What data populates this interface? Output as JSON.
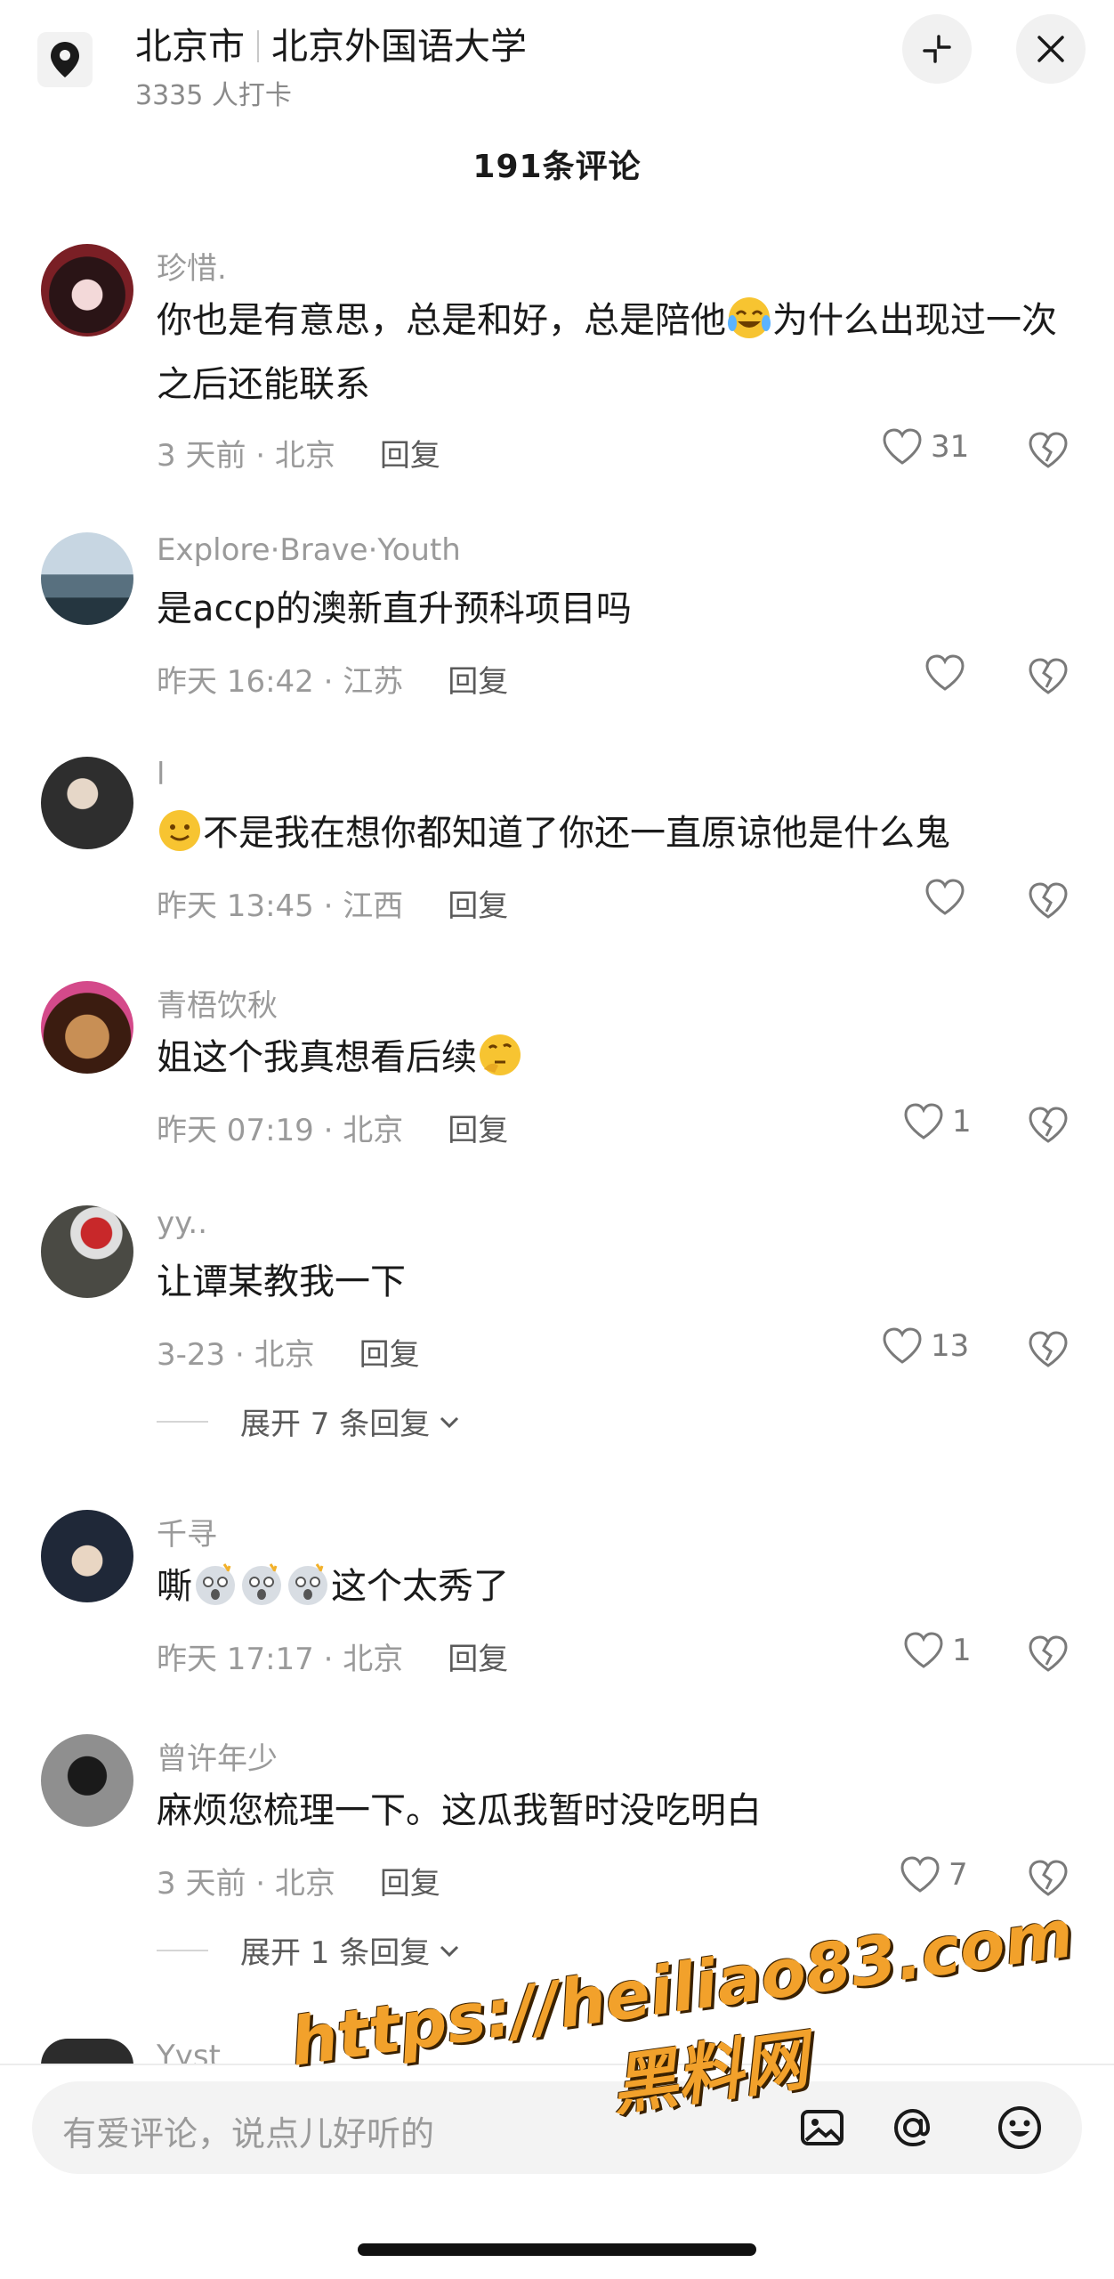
{
  "header": {
    "city": "北京市",
    "place": "北京外国语大学",
    "checkin": "3335 人打卡"
  },
  "comment_count": "191条评论",
  "comments": [
    {
      "user": "珍惜.",
      "text": "你也是有意思，总是和好，总是陪他",
      "emoji_name": "crying-laughing-emoji",
      "text_after": "为什么出现过一次之后还能联系",
      "time": "3 天前 · 北京",
      "reply": "回复",
      "likes": "31"
    },
    {
      "user": "Explore·Brave·Youth",
      "text": "是accp的澳新直升预科项目吗",
      "time": "昨天 16:42 · 江苏",
      "reply": "回复",
      "likes": ""
    },
    {
      "user": "l",
      "emoji_name": "slightly-smiling-emoji",
      "text": "不是我在想你都知道了你还一直原谅他是什么鬼",
      "time": "昨天 13:45 · 江西",
      "reply": "回复",
      "likes": ""
    },
    {
      "user": "青梧饮秋",
      "text": "姐这个我真想看后续",
      "emoji_name": "thinking-emoji",
      "time": "昨天 07:19 · 北京",
      "reply": "回复",
      "likes": "1"
    },
    {
      "user": "yy..",
      "text": "让谭某教我一下",
      "time": "3-23 · 北京",
      "reply": "回复",
      "likes": "13",
      "expand": "展开 7 条回复"
    },
    {
      "user": "千寻",
      "text": "嘶",
      "emoji_name": "shocked-emoji",
      "text_after": "这个太秀了",
      "time": "昨天 17:17 · 北京",
      "reply": "回复",
      "likes": "1"
    },
    {
      "user": "曾许年少",
      "text": "麻烦您梳理一下。这瓜我暂时没吃明白",
      "time": "3 天前 · 北京",
      "reply": "回复",
      "likes": "7",
      "expand": "展开 1 条回复"
    },
    {
      "user": "Yyst"
    }
  ],
  "input": {
    "placeholder": "有爱评论，说点儿好听的"
  },
  "watermark": {
    "url": "https://heiliao83.com",
    "name": "黑料网"
  },
  "colors": {
    "accent_text": "#1a1a1a",
    "meta_text": "#9a9a9a",
    "watermark": "#f2a12b"
  }
}
